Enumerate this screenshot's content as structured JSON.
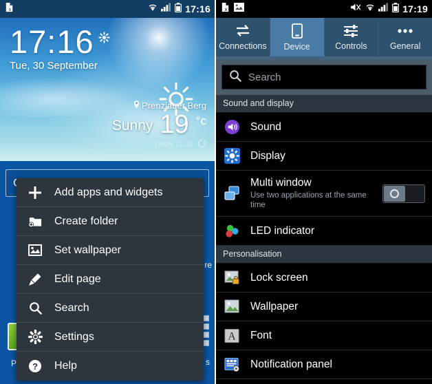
{
  "left_screen": {
    "status_bar": {
      "time": "17:16",
      "icons_left": [
        "document-error-icon"
      ],
      "icons_right": [
        "wifi-icon",
        "signal-icon",
        "battery-icon"
      ]
    },
    "clock_widget": {
      "time": "17:16",
      "date": "Tue, 30 September",
      "settings_icon": "gear-icon"
    },
    "weather_widget": {
      "location": "Prenzlauer Berg",
      "condition": "Sunny",
      "temperature": "19",
      "degree_unit": "°c",
      "updated": "18/09 11:30",
      "refresh_icon": "refresh-icon",
      "weather_icon": "sun-icon",
      "location_icon": "pin-icon"
    },
    "search_bar": {
      "label": "Google"
    },
    "dock_labels": {
      "left": "P",
      "right_upper": "re",
      "right_lower": "s"
    },
    "context_menu": {
      "items": [
        {
          "label": "Add apps and widgets",
          "icon": "plus-icon"
        },
        {
          "label": "Create folder",
          "icon": "folder-add-icon"
        },
        {
          "label": "Set wallpaper",
          "icon": "image-icon"
        },
        {
          "label": "Edit page",
          "icon": "pencil-icon"
        },
        {
          "label": "Search",
          "icon": "search-icon"
        },
        {
          "label": "Settings",
          "icon": "gear-icon"
        },
        {
          "label": "Help",
          "icon": "help-icon"
        }
      ]
    }
  },
  "right_screen": {
    "status_bar": {
      "time": "17:19",
      "icons_left": [
        "document-error-icon",
        "image-icon"
      ],
      "icons_right": [
        "mute-icon",
        "wifi-icon",
        "signal-icon",
        "battery-icon"
      ]
    },
    "tabs": [
      {
        "label": "Connections",
        "icon": "transfer-arrows-icon",
        "active": false
      },
      {
        "label": "Device",
        "icon": "phone-icon",
        "active": true
      },
      {
        "label": "Controls",
        "icon": "sliders-icon",
        "active": false
      },
      {
        "label": "General",
        "icon": "more-dots-icon",
        "active": false
      }
    ],
    "search": {
      "placeholder": "Search",
      "icon": "search-icon"
    },
    "sections": [
      {
        "header": "Sound and display",
        "rows": [
          {
            "title": "Sound",
            "subtitle": "",
            "icon": "speaker-icon",
            "icon_color": "#7c3fd4",
            "toggle": null
          },
          {
            "title": "Display",
            "subtitle": "",
            "icon": "brightness-icon",
            "icon_color": "#1f6fd4",
            "toggle": null
          },
          {
            "title": "Multi window",
            "subtitle": "Use two applications at the same time",
            "icon": "windows-icon",
            "icon_color": "#2f8ad8",
            "toggle": "off"
          },
          {
            "title": "LED indicator",
            "subtitle": "",
            "icon": "led-dots-icon",
            "icon_color": "#3ac13a",
            "toggle": null
          }
        ]
      },
      {
        "header": "Personalisation",
        "rows": [
          {
            "title": "Lock screen",
            "subtitle": "",
            "icon": "lock-screen-icon",
            "icon_color": "#8fb96b",
            "toggle": null
          },
          {
            "title": "Wallpaper",
            "subtitle": "",
            "icon": "wallpaper-icon",
            "icon_color": "#8fb96b",
            "toggle": null
          },
          {
            "title": "Font",
            "subtitle": "",
            "icon": "font-a-icon",
            "icon_color": "#c9c9c9",
            "toggle": null
          },
          {
            "title": "Notification panel",
            "subtitle": "",
            "icon": "notification-panel-icon",
            "icon_color": "#2f6fd0",
            "toggle": null
          }
        ]
      }
    ]
  },
  "theme": {
    "accent_blue": "#4a7ba4",
    "tab_bar": "#2e516d",
    "menu_bg": "#2e363d",
    "list_bg": "#000000",
    "section_header_bg": "#2b3640"
  }
}
